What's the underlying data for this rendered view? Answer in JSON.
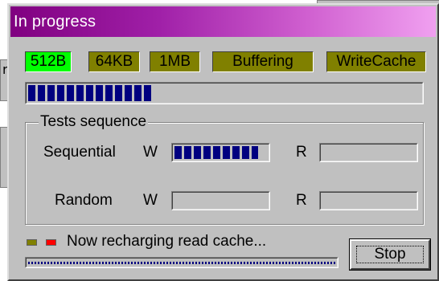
{
  "window": {
    "title": "In progress",
    "title_gradient": [
      "#800080",
      "#f0a0f0"
    ]
  },
  "background": {
    "left_fragment_text": "r"
  },
  "stages": [
    {
      "label": "512B",
      "active": true
    },
    {
      "label": "64KB",
      "active": false
    },
    {
      "label": "1MB",
      "active": false
    },
    {
      "label": "Buffering",
      "active": false
    },
    {
      "label": "WriteCache",
      "active": false
    }
  ],
  "colors": {
    "stage_active": "#00ff00",
    "stage_inactive": "#808000",
    "progress": "#000080",
    "led_yellow": "#808000",
    "led_red": "#ff0000"
  },
  "overall_progress": 0.32,
  "tests": {
    "group_label": "Tests sequence",
    "sequential": {
      "label": "Sequential",
      "write_label": "W",
      "read_label": "R",
      "write_progress": 0.9,
      "read_progress": 0
    },
    "random": {
      "label": "Random",
      "write_label": "W",
      "read_label": "R",
      "write_progress": 0,
      "read_progress": 0
    }
  },
  "status": {
    "text": "Now recharging read cache...",
    "progress": 1.0,
    "leds": [
      "yellow-led",
      "red-led"
    ]
  },
  "buttons": {
    "stop_label": "Stop"
  }
}
